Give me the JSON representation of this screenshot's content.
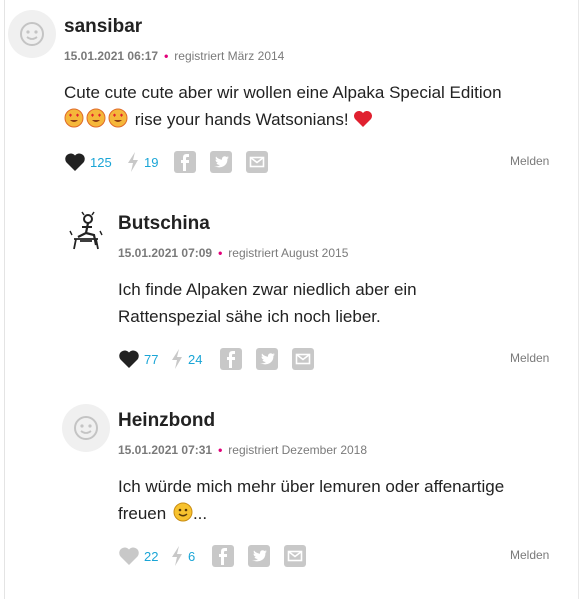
{
  "comments": [
    {
      "username": "sansibar",
      "date": "15.01.2021 06:17",
      "registered": "registriert März 2014",
      "text_line1": "Cute cute cute aber wir wollen eine Alpaka Special Edition",
      "text_line2": "rise your hands Watsonians!",
      "likes": "125",
      "flashes": "19",
      "report_label": "Melden",
      "liked": true
    },
    {
      "username": "Butschina",
      "date": "15.01.2021 07:09",
      "registered": "registriert August 2015",
      "text_line1": "Ich finde Alpaken zwar niedlich aber ein",
      "text_line2": "Rattenspezial sähe ich noch lieber.",
      "likes": "77",
      "flashes": "24",
      "report_label": "Melden",
      "liked": true
    },
    {
      "username": "Heinzbond",
      "date": "15.01.2021 07:31",
      "registered": "registriert Dezember 2018",
      "text_line1": "Ich würde mich mehr über lemuren oder affenartige",
      "text_line2": "freuen",
      "text_line2_suffix": "...",
      "likes": "22",
      "flashes": "6",
      "report_label": "Melden",
      "liked": false
    }
  ],
  "colors": {
    "accent_dot": "#e2007a",
    "count_blue": "#1aa5d6",
    "icon_grey": "#c8c8c8",
    "heart_red": "#e0202f"
  },
  "icons": [
    "avatar-placeholder-icon",
    "avatar-drawing-icon",
    "heart-icon",
    "flash-icon",
    "facebook-icon",
    "twitter-icon",
    "mail-icon",
    "heart-eyes-emoji-icon",
    "red-heart-emoji-icon",
    "smiley-emoji-icon"
  ]
}
